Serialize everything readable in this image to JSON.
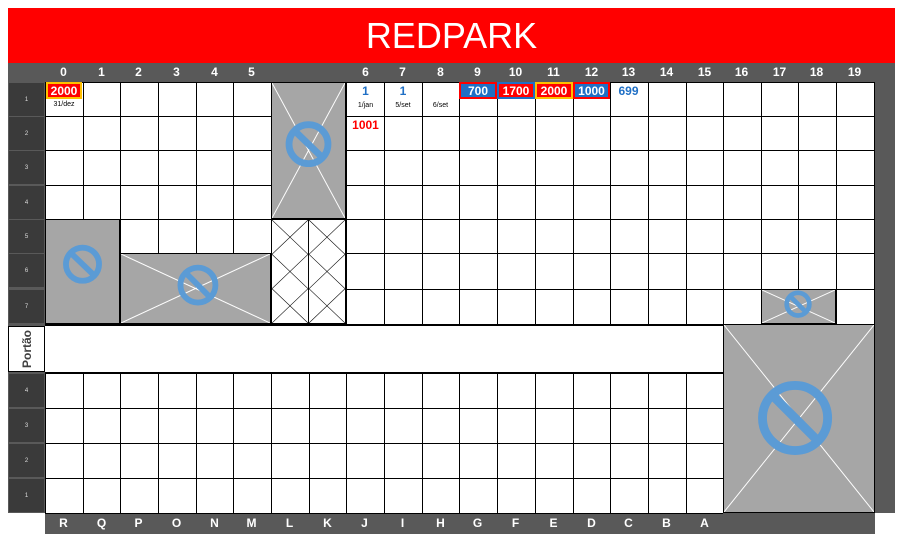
{
  "title": "REDPARK",
  "gate_label": "Portão",
  "column_numbers": [
    "0",
    "1",
    "2",
    "3",
    "4",
    "5",
    "6",
    "7",
    "8",
    "9",
    "10",
    "11",
    "12",
    "13",
    "14",
    "15",
    "16",
    "17",
    "18",
    "19"
  ],
  "top_rows": [
    "1",
    "2",
    "3",
    "4",
    "5",
    "6",
    "7"
  ],
  "bottom_rows": [
    "4",
    "3",
    "2",
    "1"
  ],
  "bottom_letters": [
    "R",
    "Q",
    "P",
    "O",
    "N",
    "M",
    "L",
    "K",
    "J",
    "I",
    "H",
    "G",
    "F",
    "E",
    "D",
    "C",
    "B",
    "A"
  ],
  "reservations": {
    "c0": {
      "amount": "2000",
      "date": "31/dez"
    },
    "c6": {
      "amount": "1",
      "date": "1/jan"
    },
    "c6_row2": {
      "amount": "1001"
    },
    "c7": {
      "amount": "1",
      "date": "5/set"
    },
    "c8": {
      "date": "6/set"
    },
    "c9": {
      "amount": "700"
    },
    "c10": {
      "amount": "1700"
    },
    "c11": {
      "amount": "2000"
    },
    "c12": {
      "amount": "1000"
    },
    "c13": {
      "amount": "699"
    }
  },
  "icons": {
    "blocked": "no-entry-icon"
  },
  "colors": {
    "banner": "#ff0000",
    "bars": "#595959",
    "blocked_area": "#a6a6a6",
    "sign": "#5b9bd5",
    "blue_tag": "#1f6fc5",
    "red_tag": "#ff0000"
  }
}
